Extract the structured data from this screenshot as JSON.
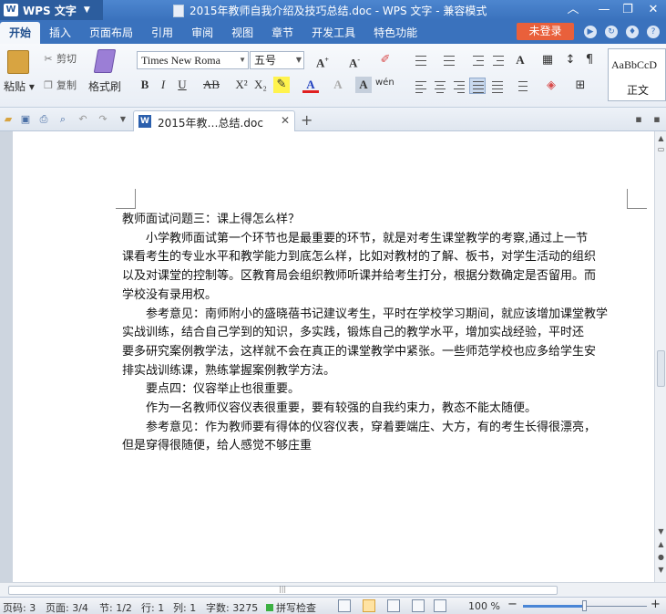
{
  "app": {
    "name": "WPS 文字",
    "window_title": "2015年教师自我介绍及技巧总结.doc - WPS 文字 - 兼容模式"
  },
  "ribbon_tabs": [
    "开始",
    "插入",
    "页面布局",
    "引用",
    "审阅",
    "视图",
    "章节",
    "开发工具",
    "特色功能"
  ],
  "login_label": "未登录",
  "clipboard": {
    "paste": "粘贴",
    "cut": "剪切",
    "copy": "复制",
    "format_painter": "格式刷"
  },
  "font": {
    "family": "Times New Roma",
    "size": "五号"
  },
  "styles": {
    "sample": "AaBbCcD",
    "name": "正文"
  },
  "doc_tab": {
    "label": "2015年教…总结.doc"
  },
  "document": {
    "heading": "教师面试问题三：课上得怎么样？",
    "lines": [
      {
        "indent": true,
        "text": "小学教师面试第一个环节也是最重要的环节，就是对考生课堂教学的考察,通过上一节"
      },
      {
        "indent": false,
        "text": "课看考生的专业水平和教学能力到底怎么样，比如对教材的了解、板书，对学生活动的组织"
      },
      {
        "indent": false,
        "text": "以及对课堂的控制等。区教育局会组织教师听课并给考生打分，根据分数确定是否留用。而"
      },
      {
        "indent": false,
        "text": "学校没有录用权。"
      },
      {
        "indent": true,
        "text": "参考意见：南师附小的盛晓蓓书记建议考生，平时在学校学习期间，就应该增加课堂教学"
      },
      {
        "indent": false,
        "text": "实战训练，结合自己学到的知识，多实践，锻炼自己的教学水平，增加实战经验，平时还"
      },
      {
        "indent": false,
        "text": "要多研究案例教学法，这样就不会在真正的课堂教学中紧张。一些师范学校也应多给学生安"
      },
      {
        "indent": false,
        "text": "排实战训练课，熟练掌握案例教学方法。"
      },
      {
        "indent": true,
        "text": "要点四：仪容举止也很重要。"
      },
      {
        "indent": true,
        "text": "作为一名教师仪容仪表很重要，要有较强的自我约束力，教态不能太随便。"
      },
      {
        "indent": true,
        "text": "参考意见：作为教师要有得体的仪容仪表，穿着要端庄、大方，有的考生长得很漂亮，"
      },
      {
        "indent": false,
        "text": "但是穿得很随便，给人感觉不够庄重"
      }
    ]
  },
  "status": {
    "page_code": "页码: 3",
    "page": "页面: 3/4",
    "section": "节: 1/2",
    "row": "行: 1",
    "col": "列: 1",
    "word_count": "字数: 3275",
    "spell_check": "拼写检查",
    "zoom": "100 %",
    "zoom_fraction": 0.5
  }
}
